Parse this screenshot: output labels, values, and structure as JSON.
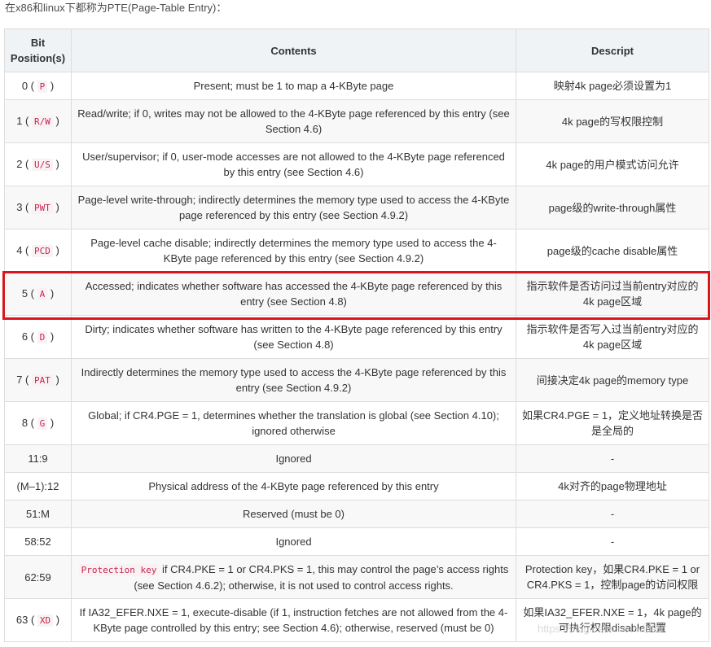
{
  "intro": "在x86和linux下都称为PTE(Page-Table Entry)：",
  "headers": {
    "bit_line1": "Bit",
    "bit_line2": "Position(s)",
    "contents": "Contents",
    "descript": "Descript"
  },
  "rows": [
    {
      "bit": "0",
      "code": "P",
      "contents": "Present; must be 1 to map a 4-KByte page",
      "descript": "映射4k page必须设置为1"
    },
    {
      "bit": "1",
      "code": "R/W",
      "contents": "Read/write; if 0, writes may not be allowed to the 4-KByte page referenced by this entry (see Section 4.6)",
      "descript": "4k page的写权限控制"
    },
    {
      "bit": "2",
      "code": "U/S",
      "contents": "User/supervisor; if 0, user-mode accesses are not allowed to the 4-KByte page referenced by this entry (see Section 4.6)",
      "descript": "4k page的用户模式访问允许"
    },
    {
      "bit": "3",
      "code": "PWT",
      "contents": "Page-level write-through; indirectly determines the memory type used to access the 4-KByte page referenced by this entry (see Section 4.9.2)",
      "descript": "page级的write-through属性"
    },
    {
      "bit": "4",
      "code": "PCD",
      "contents": "Page-level cache disable; indirectly determines the memory type used to access the 4-KByte page referenced by this entry (see Section 4.9.2)",
      "descript": "page级的cache disable属性"
    },
    {
      "bit": "5",
      "code": "A",
      "contents": "Accessed; indicates whether software has accessed the 4-KByte page referenced by this entry (see Section 4.8)",
      "descript": "指示软件是否访问过当前entry对应的4k page区域"
    },
    {
      "bit": "6",
      "code": "D",
      "contents": "Dirty; indicates whether software has written to the 4-KByte page referenced by this entry (see Section 4.8)",
      "descript": "指示软件是否写入过当前entry对应的4k page区域"
    },
    {
      "bit": "7",
      "code": "PAT",
      "contents": "Indirectly determines the memory type used to access the 4-KByte page referenced by this entry (see Section 4.9.2)",
      "descript": "间接决定4k page的memory type"
    },
    {
      "bit": "8",
      "code": "G",
      "contents": "Global; if CR4.PGE = 1, determines whether the translation is global (see Section 4.10); ignored otherwise",
      "descript": "如果CR4.PGE = 1，定义地址转换是否是全局的"
    },
    {
      "bit": "11:9",
      "contents": "Ignored",
      "descript": "-"
    },
    {
      "bit": "(M–1):12",
      "contents": "Physical address of the 4-KByte page referenced by this entry",
      "descript": "4k对齐的page物理地址"
    },
    {
      "bit": "51:M",
      "contents": "Reserved (must be 0)",
      "descript": "-"
    },
    {
      "bit": "58:52",
      "contents": "Ignored",
      "descript": "-"
    },
    {
      "bit": "62:59",
      "contents_code": "Protection key",
      "contents": " if CR4.PKE = 1 or CR4.PKS = 1, this may control the page’s access rights (see Section 4.6.2); otherwise, it is not used to control access rights.",
      "descript": "Protection key，如果CR4.PKE = 1 or CR4.PKS = 1，控制page的访问权限"
    },
    {
      "bit": "63",
      "code": "XD",
      "contents": "If IA32_EFER.NXE = 1, execute-disable (if 1, instruction fetches are not allowed from the 4-KByte page controlled by this entry; see Section 4.6); otherwise, reserved (must be 0)",
      "descript": "如果IA32_EFER.NXE = 1，4k page的可执行权限disable配置"
    }
  ],
  "watermark": "https://blog.csdn.net/wl999",
  "colors": {
    "highlight": "#d9161c",
    "code_text": "#c7254e",
    "code_bg": "#f9f2f4",
    "header_bg": "#eff3f5",
    "border": "#dddddd"
  }
}
